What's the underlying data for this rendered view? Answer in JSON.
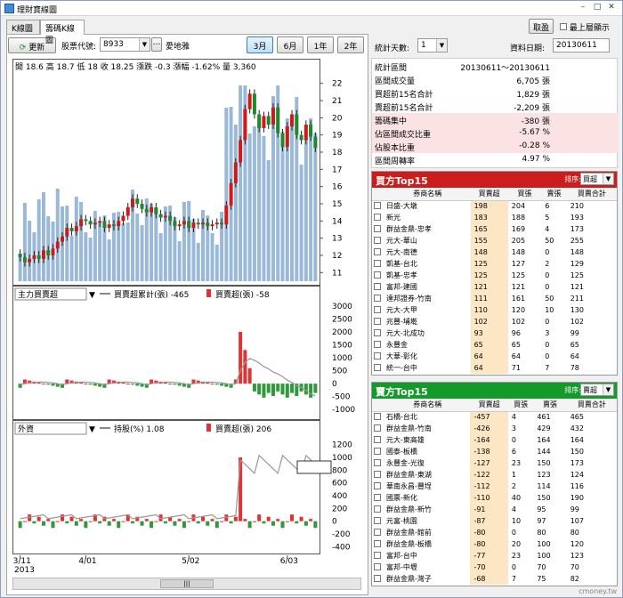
{
  "window": {
    "title": "理財寶線圖"
  },
  "tabs": [
    "K線圖",
    "籌碼K線圖"
  ],
  "topright": {
    "button": "取盈",
    "checkbox_label": "最上層顯示"
  },
  "toolbar": {
    "refresh": "更新",
    "stock_label": "股票代號:",
    "stock_code": "8933",
    "stock_name": "愛地雅",
    "ranges": [
      "3月",
      "6月",
      "1年",
      "2年"
    ],
    "active_range": "3月"
  },
  "stats": {
    "days_label": "統計天數:",
    "days_value": "1",
    "date_label": "資料日期:",
    "date_value": "20130611",
    "rows": [
      {
        "k": "統計區間",
        "v": "20130611～20130611",
        "hl": false
      },
      {
        "k": "區間成交量",
        "v": "6,705 張",
        "hl": false
      },
      {
        "k": "買超前15名合計",
        "v": "1,829 張",
        "hl": false
      },
      {
        "k": "賣超前15名合計",
        "v": "-2,209 張",
        "hl": false
      },
      {
        "k": "籌碼集中",
        "v": "-380 張",
        "hl": true
      },
      {
        "k": "佔區間成交比重",
        "v": "-5.67 %",
        "hl": true
      },
      {
        "k": "佔股本比重",
        "v": "-0.28 %",
        "hl": true
      },
      {
        "k": "區間周轉率",
        "v": "4.97 %",
        "hl": false
      }
    ]
  },
  "buy": {
    "title": "買方Top15",
    "sort_label": "排序:",
    "sort_value": "買超",
    "cols": [
      "券商名稱",
      "買賣超",
      "買張",
      "賣張",
      "買賣合計"
    ],
    "rows": [
      [
        "日盛-大墩",
        "198",
        "204",
        "6",
        "210"
      ],
      [
        "新光",
        "183",
        "188",
        "5",
        "193"
      ],
      [
        "群益金鼎-忠孝",
        "165",
        "169",
        "4",
        "173"
      ],
      [
        "元大-華山",
        "155",
        "205",
        "50",
        "255"
      ],
      [
        "元大-南德",
        "148",
        "148",
        "0",
        "148"
      ],
      [
        "凱基-台北",
        "125",
        "127",
        "2",
        "129"
      ],
      [
        "凱基-忠孝",
        "125",
        "125",
        "0",
        "125"
      ],
      [
        "富邦-建國",
        "121",
        "121",
        "0",
        "121"
      ],
      [
        "達邦證券-竹南",
        "111",
        "161",
        "50",
        "211"
      ],
      [
        "元大-大甲",
        "110",
        "120",
        "10",
        "130"
      ],
      [
        "兆豐-埔墘",
        "102",
        "102",
        "0",
        "102"
      ],
      [
        "元大-北成功",
        "93",
        "96",
        "3",
        "99"
      ],
      [
        "永豐金",
        "65",
        "65",
        "0",
        "65"
      ],
      [
        "大華-彰化",
        "64",
        "64",
        "0",
        "64"
      ],
      [
        "統一-台中",
        "64",
        "71",
        "7",
        "78"
      ]
    ]
  },
  "sell": {
    "title": "賣方Top15",
    "sort_label": "排序:",
    "sort_value": "賣超",
    "cols": [
      "券商名稱",
      "買賣超",
      "買張",
      "賣張",
      "買賣合計"
    ],
    "rows": [
      [
        "石橋-台北",
        "-457",
        "4",
        "461",
        "465"
      ],
      [
        "群益金鼎-竹南",
        "-426",
        "3",
        "429",
        "432"
      ],
      [
        "元大-東高雄",
        "-164",
        "0",
        "164",
        "164"
      ],
      [
        "國泰-板橋",
        "-138",
        "6",
        "144",
        "150"
      ],
      [
        "永豐金-光復",
        "-127",
        "23",
        "150",
        "173"
      ],
      [
        "群益金鼎-東湖",
        "-122",
        "1",
        "123",
        "124"
      ],
      [
        "華南永昌-豐埕",
        "-112",
        "2",
        "114",
        "116"
      ],
      [
        "國票-新化",
        "-110",
        "40",
        "150",
        "190"
      ],
      [
        "群益金鼎-新竹",
        "-91",
        "4",
        "95",
        "99"
      ],
      [
        "元富-桃園",
        "-87",
        "10",
        "97",
        "107"
      ],
      [
        "群益金鼎-館前",
        "-80",
        "0",
        "80",
        "80"
      ],
      [
        "群益金鼎-板橋",
        "-80",
        "20",
        "100",
        "120"
      ],
      [
        "富邦-台中",
        "-77",
        "23",
        "100",
        "123"
      ],
      [
        "富邦-中壢",
        "-70",
        "0",
        "70",
        "70"
      ],
      [
        "群益金鼎-灣子",
        "-68",
        "7",
        "75",
        "82"
      ]
    ]
  },
  "chart_data": [
    {
      "type": "bar",
      "title": "開 18.6 高 18.7 低 18 收 18.25 漲跌 -0.3 漲幅 -1.62% 量 3,360",
      "ohlc": {
        "open": "18.6",
        "high": "18.7",
        "low": "18",
        "close": "18.25"
      },
      "info": {
        "chg_label": "漲跌 -0.3",
        "pct_label": "漲幅 -1.62%",
        "vol_label": "量 3,360"
      },
      "ylim": [
        10.5,
        22.5
      ],
      "yticks": [
        "22",
        "21",
        "20",
        "19",
        "18",
        "17",
        "16",
        "15",
        "14",
        "13",
        "12",
        "11"
      ],
      "xticks": [
        "3/11",
        "4/01",
        "5/02",
        "6/03"
      ],
      "xyear": "2013",
      "closes": [
        11.9,
        11.6,
        11.8,
        12.0,
        11.8,
        12.3,
        12.0,
        12.4,
        12.8,
        13.1,
        13.6,
        13.4,
        13.7,
        14.1,
        14.0,
        13.8,
        13.9,
        14.0,
        13.6,
        13.8,
        13.7,
        14.0,
        14.3,
        14.8,
        15.3,
        15.0,
        14.7,
        14.5,
        14.8,
        14.4,
        14.2,
        14.3,
        14.0,
        13.7,
        13.8,
        14.0,
        13.6,
        13.9,
        13.8,
        13.9,
        13.7,
        13.8,
        13.9,
        13.8,
        14.9,
        16.2,
        17.4,
        18.7,
        20.5,
        21.4,
        20.2,
        19.4,
        20.1,
        19.6,
        20.6,
        19.1,
        18.3,
        19.5,
        20.2,
        19.0,
        18.7,
        19.6,
        18.9,
        18.25
      ]
    },
    {
      "type": "bar",
      "series_name": "主力買賣超",
      "legend_line": "買賣超累計(張) -465",
      "legend_bar": "買賣超(張) -58",
      "yticks": [
        "3000",
        "2500",
        "2000",
        "1500",
        "1000",
        "500",
        "0",
        "-500",
        "-1000"
      ],
      "ylim": [
        -1200,
        3100
      ]
    },
    {
      "type": "bar",
      "series_name": "外資",
      "legend_line": "持股(%) 1.08",
      "legend_bar": "買賣超(張) 206",
      "yticks": [
        "1200",
        "1000",
        "800",
        "600",
        "400",
        "200",
        "0",
        "-200",
        "-400"
      ],
      "ylim": [
        -450,
        1250
      ]
    }
  ],
  "watermark": "cmoney.tw",
  "scroll": "|||"
}
